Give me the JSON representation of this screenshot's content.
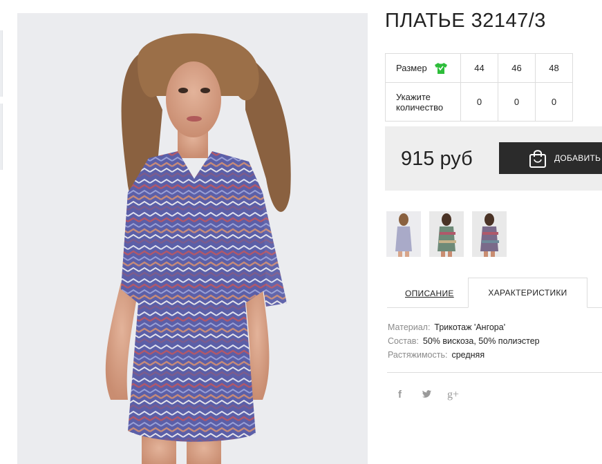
{
  "product": {
    "title": "ПЛАТЬЕ 32147/3"
  },
  "size_table": {
    "size_label": "Размер",
    "sizes": [
      "44",
      "46",
      "48"
    ],
    "quantity_label_line1": "Укажите",
    "quantity_label_line2": "количество",
    "quantities": [
      "0",
      "0",
      "0"
    ]
  },
  "purchase": {
    "price": "915 руб",
    "add_label": "ДОБАВИТЬ"
  },
  "tabs": {
    "description": "ОПИСАНИЕ",
    "characteristics": "ХАРАКТЕРИСТИКИ",
    "active": "characteristics"
  },
  "characteristics": [
    {
      "key": "Материал:",
      "value": "Трикотаж 'Ангора'"
    },
    {
      "key": "Состав:",
      "value": "50% вискоза, 50% полиэстер"
    },
    {
      "key": "Растяжимость:",
      "value": "средняя"
    }
  ],
  "social": {
    "facebook_icon": "f",
    "twitter_icon": "t",
    "gplus_icon": "g+"
  },
  "colors": {
    "accent_green": "#2dbd3a",
    "button_dark": "#2b2b2b",
    "price_bg": "#eeeeee",
    "dress_blue": "#5b5fa8",
    "dress_red": "#b0586a"
  }
}
